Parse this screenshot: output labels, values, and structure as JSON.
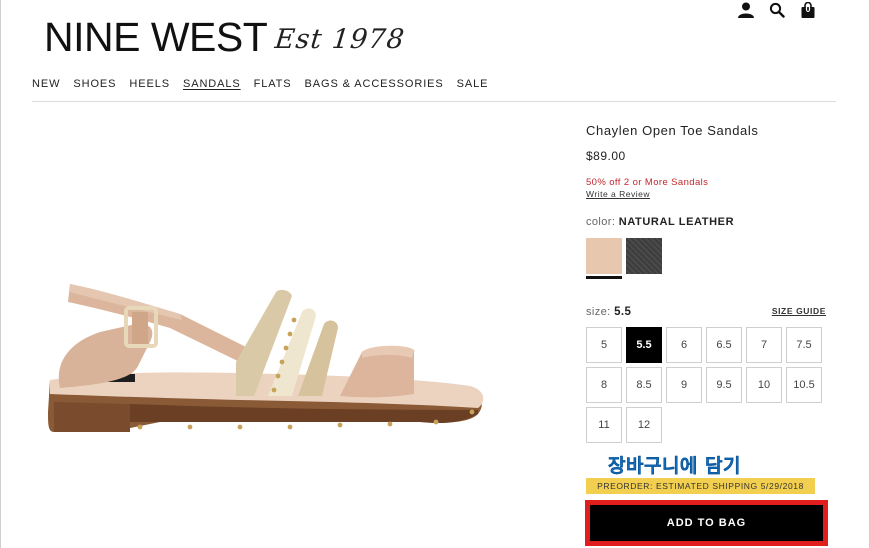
{
  "brand": {
    "name": "NINE WEST",
    "established": "Est 1978"
  },
  "header": {
    "icons": [
      "account-icon",
      "search-icon",
      "shopping-bag-icon"
    ],
    "bag_count": "0"
  },
  "nav": {
    "items": [
      {
        "label": "NEW",
        "active": false
      },
      {
        "label": "SHOES",
        "active": false
      },
      {
        "label": "HEELS",
        "active": false
      },
      {
        "label": "SANDALS",
        "active": true
      },
      {
        "label": "FLATS",
        "active": false
      },
      {
        "label": "BAGS & ACCESSORIES",
        "active": false
      },
      {
        "label": "SALE",
        "active": false
      }
    ]
  },
  "product": {
    "title": "Chaylen Open Toe Sandals",
    "price": "$89.00",
    "promo": "50% off 2 or More Sandals",
    "review_link": "Write a Review",
    "color_label": "color:",
    "color_value": "NATURAL LEATHER",
    "swatches": [
      {
        "name": "natural leather",
        "hex": "#e7c7ae",
        "selected": true
      },
      {
        "name": "black",
        "hex": "#454545",
        "selected": false
      }
    ],
    "size_label": "size:",
    "size_value": "5.5",
    "size_guide": "SIZE GUIDE",
    "sizes": [
      {
        "label": "5",
        "selected": false
      },
      {
        "label": "5.5",
        "selected": true
      },
      {
        "label": "6",
        "selected": false
      },
      {
        "label": "6.5",
        "selected": false
      },
      {
        "label": "7",
        "selected": false
      },
      {
        "label": "7.5",
        "selected": false
      },
      {
        "label": "8",
        "selected": false
      },
      {
        "label": "8.5",
        "selected": false
      },
      {
        "label": "9",
        "selected": false
      },
      {
        "label": "9.5",
        "selected": false
      },
      {
        "label": "10",
        "selected": false
      },
      {
        "label": "10.5",
        "selected": false
      },
      {
        "label": "11",
        "selected": false
      },
      {
        "label": "12",
        "selected": false
      }
    ],
    "preorder_note": "PREORDER: ESTIMATED SHIPPING 5/29/2018",
    "add_to_bag": "ADD TO BAG"
  },
  "overlay": {
    "korean_caption": "장바구니에 담기",
    "caption_color": "#1f7fd0",
    "highlight_color": "#e01e1e"
  },
  "colors": {
    "promo": "#c0272d",
    "preorder_bg": "#f3cf4f",
    "button_bg": "#000000"
  }
}
